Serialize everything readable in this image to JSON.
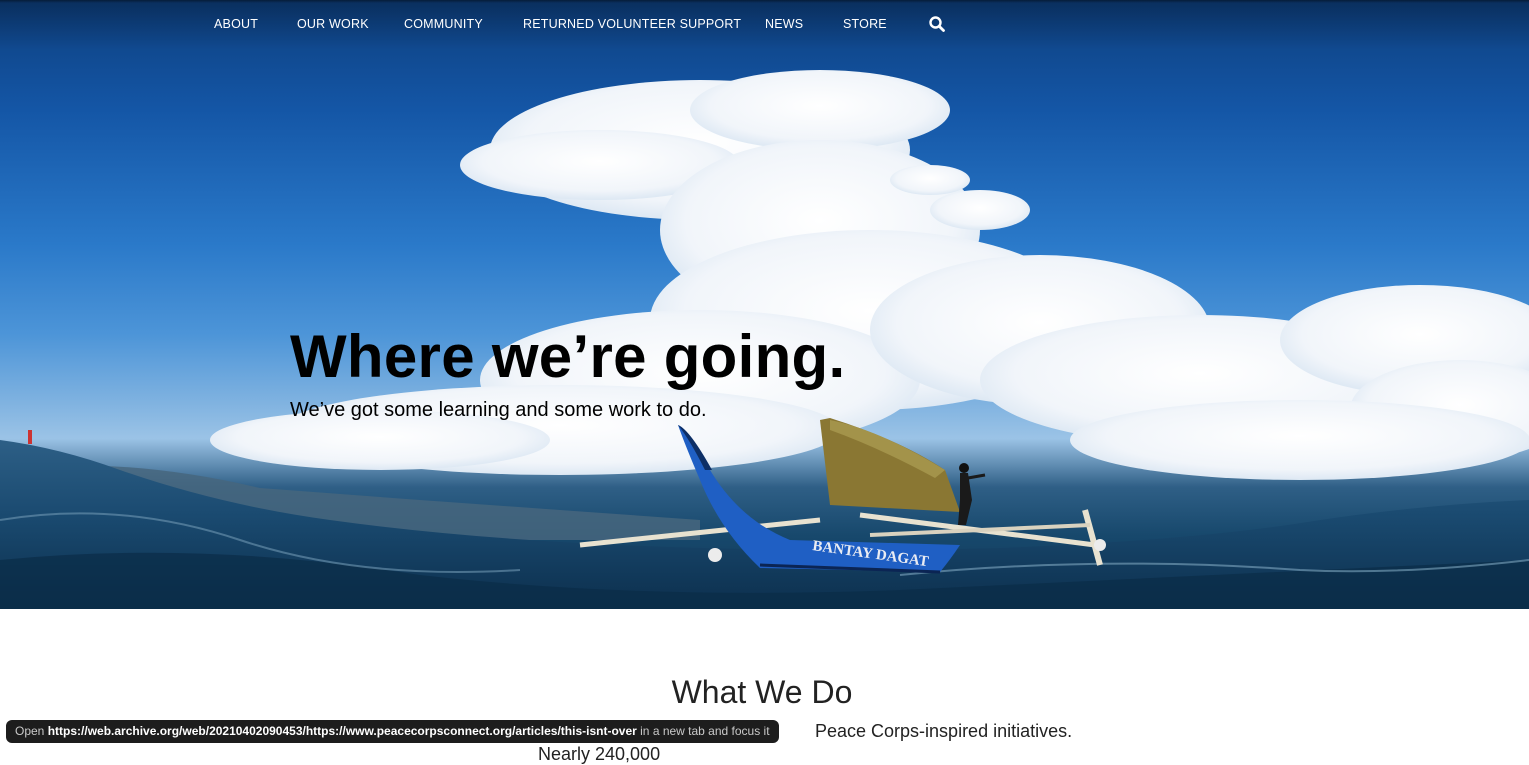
{
  "nav": {
    "items": [
      {
        "label": "ABOUT"
      },
      {
        "label": "OUR WORK"
      },
      {
        "label": "COMMUNITY"
      },
      {
        "label": "RETURNED VOLUNTEER SUPPORT"
      },
      {
        "label": "NEWS"
      },
      {
        "label": "STORE"
      }
    ],
    "search_icon": "search-icon"
  },
  "hero": {
    "title": "Where we’re going.",
    "subtitle": "We’ve got some learning and some work to do.",
    "boat_text": "BANTAY DAGAT"
  },
  "section": {
    "title": "What We Do",
    "line1_visible": "Peace Corps-inspired initiatives.",
    "line2_visible": "Nearly 240,000"
  },
  "status_tooltip": {
    "prefix": "Open",
    "url": "https://web.archive.org/web/20210402090453/https://www.peacecorpsconnect.org/articles/this-isnt-over",
    "suffix": "in a new tab and focus it"
  },
  "colors": {
    "sky_top": "#0d3f7e",
    "sky_mid": "#2a79c9",
    "sea": "#17486c",
    "boat_blue": "#1f5fc4",
    "tooltip_bg": "#0c0c0c"
  }
}
